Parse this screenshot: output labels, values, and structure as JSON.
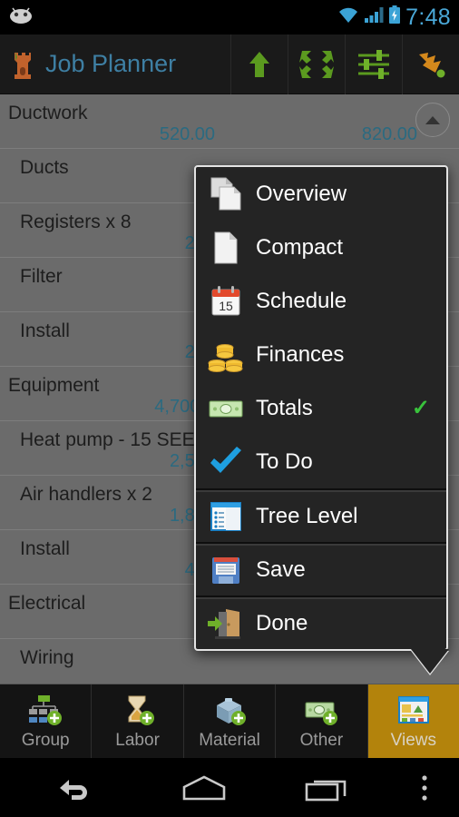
{
  "statusbar": {
    "time": "7:48",
    "icons": [
      "android-robot-icon",
      "wifi-icon",
      "cell-signal-icon",
      "battery-charging-icon"
    ]
  },
  "actionbar": {
    "logo_icon": "castle-rook-logo-icon",
    "title": "Job Planner",
    "actions": [
      {
        "name": "up-arrow-icon",
        "label": "Up"
      },
      {
        "name": "collapse-all-icon",
        "label": "Collapse All"
      },
      {
        "name": "settings-sliders-icon",
        "label": "Settings"
      },
      {
        "name": "down-right-arrow-icon",
        "label": "Move Down"
      }
    ]
  },
  "list": {
    "rows": [
      {
        "label": "Ductwork",
        "level": 0,
        "v1": "520.00",
        "v2": "820.00",
        "collapse": true
      },
      {
        "label": "Ducts",
        "level": 1,
        "v1": "",
        "v2": ""
      },
      {
        "label": "Registers x 8",
        "level": 1,
        "v1": "280",
        "v2": ""
      },
      {
        "label": "Filter",
        "level": 1,
        "v1": "",
        "v2": ""
      },
      {
        "label": "Install",
        "level": 1,
        "v1": "240",
        "v2": ""
      },
      {
        "label": "Equipment",
        "level": 0,
        "v1": "4,700.0",
        "v2": ""
      },
      {
        "label": "Heat pump - 15 SEER",
        "level": 1,
        "v1": "2,500",
        "v2": ""
      },
      {
        "label": "Air handlers x 2",
        "level": 1,
        "v1": "1,800",
        "v2": ""
      },
      {
        "label": "Install",
        "level": 1,
        "v1": "400",
        "v2": ""
      },
      {
        "label": "Electrical",
        "level": 0,
        "v1": "",
        "v2": ""
      },
      {
        "label": "Wiring",
        "level": 1,
        "v1": "",
        "v2": ""
      }
    ]
  },
  "popup": {
    "items": [
      {
        "label": "Overview",
        "icon": "documents-copy-icon",
        "checked": false,
        "separator": false
      },
      {
        "label": "Compact",
        "icon": "document-page-icon",
        "checked": false,
        "separator": false
      },
      {
        "label": "Schedule",
        "icon": "calendar-15-icon",
        "checked": false,
        "separator": false
      },
      {
        "label": "Finances",
        "icon": "gold-coins-icon",
        "checked": false,
        "separator": false
      },
      {
        "label": "Totals",
        "icon": "dollar-bill-icon",
        "checked": true,
        "separator": false
      },
      {
        "label": "To Do",
        "icon": "blue-checkmark-icon",
        "checked": false,
        "separator": false
      },
      {
        "label": "Tree Level",
        "icon": "tree-list-panel-icon",
        "checked": false,
        "separator": true
      },
      {
        "label": "Save",
        "icon": "floppy-disk-icon",
        "checked": false,
        "separator": true
      },
      {
        "label": "Done",
        "icon": "exit-door-icon",
        "checked": false,
        "separator": true
      }
    ],
    "check_glyph": "✓",
    "check_color": "#39c23c"
  },
  "tabbar": {
    "tabs": [
      {
        "label": "Group",
        "icon": "add-group-icon",
        "active": false
      },
      {
        "label": "Labor",
        "icon": "add-labor-icon",
        "active": false
      },
      {
        "label": "Material",
        "icon": "add-material-icon",
        "active": false
      },
      {
        "label": "Other",
        "icon": "add-other-icon",
        "active": false
      },
      {
        "label": "Views",
        "icon": "views-window-icon",
        "active": true
      }
    ],
    "active_color": "#b3830c"
  },
  "navbar": {
    "buttons": [
      {
        "name": "back-nav-icon",
        "label": "Back"
      },
      {
        "name": "home-nav-icon",
        "label": "Home"
      },
      {
        "name": "recents-nav-icon",
        "label": "Recents"
      },
      {
        "name": "overflow-nav-icon",
        "label": "Menu"
      }
    ]
  }
}
